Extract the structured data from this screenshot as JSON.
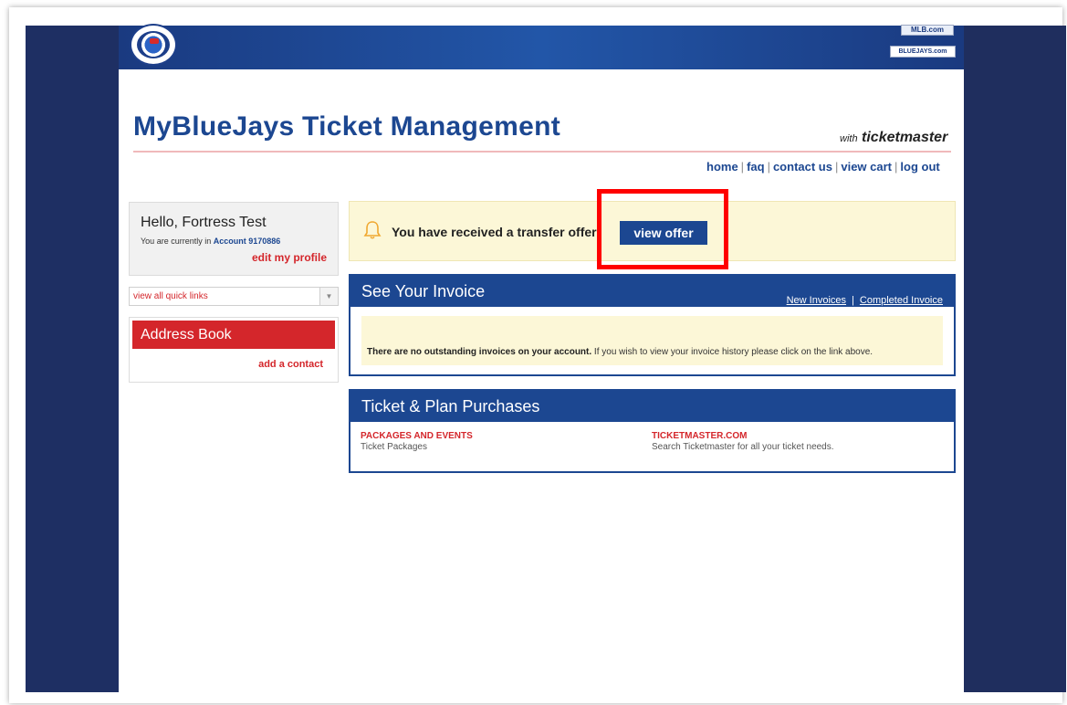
{
  "header": {
    "mlb_badge": "MLB.com",
    "bluejays_badge": "BLUEJAYS.com",
    "page_title": "MyBlueJays Ticket Management",
    "with_label": "with",
    "brand": "ticketmaster"
  },
  "nav": {
    "items": [
      "home",
      "faq",
      "contact us",
      "view cart",
      "log out"
    ]
  },
  "sidebar": {
    "greeting": "Hello, Fortress Test",
    "account_prefix": "You are currently in",
    "account": "Account 9170886",
    "edit_profile": "edit my profile",
    "quick_links": "view all quick links",
    "address_book": "Address Book",
    "add_contact": "add a contact"
  },
  "notice": {
    "text": "You have received a transfer offer!",
    "button": "view offer"
  },
  "invoice": {
    "title": "See Your Invoice",
    "link_new": "New Invoices",
    "link_sep": "|",
    "link_completed": "Completed Invoice",
    "message_bold": "There are no outstanding invoices on your account.",
    "message_rest": " If you wish to view your invoice history please click on the link above."
  },
  "purchases": {
    "title": "Ticket & Plan Purchases",
    "left_head": "PACKAGES AND EVENTS",
    "left_sub": "Ticket Packages",
    "right_head": "TICKETMASTER.COM",
    "right_sub": "Search Ticketmaster for all your ticket needs."
  },
  "colors": {
    "primary_blue": "#1c4791",
    "accent_red": "#d4262b",
    "notice_bg": "#fcf7d7",
    "highlight": "#ff0000"
  }
}
